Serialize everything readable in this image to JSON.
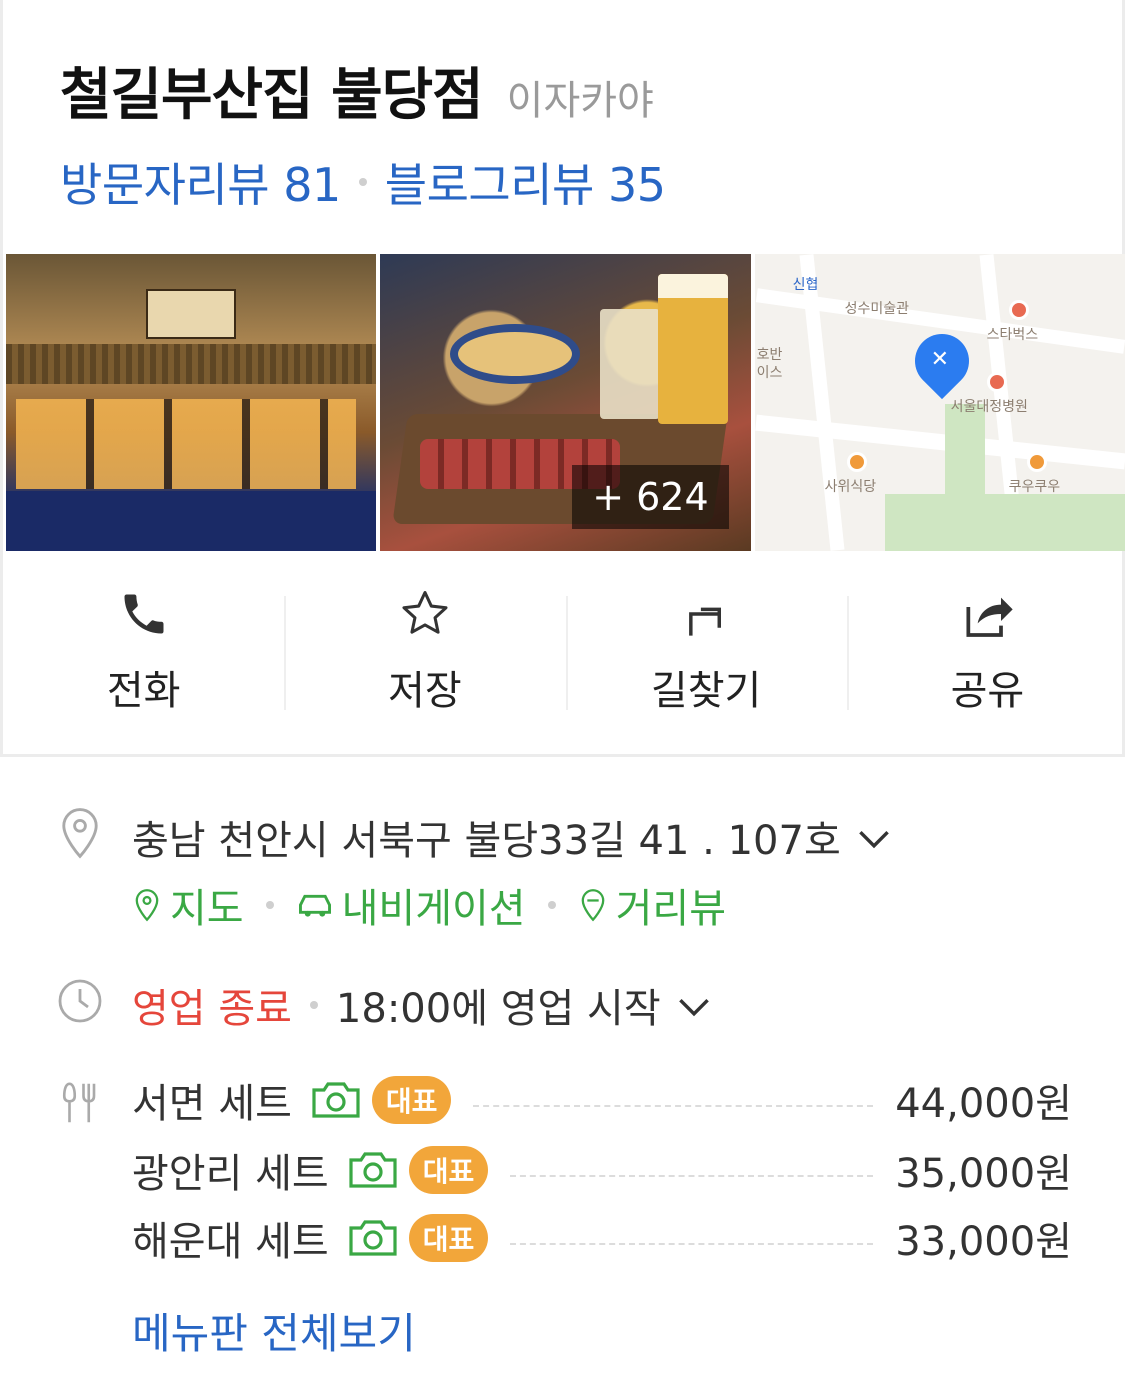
{
  "place": {
    "name": "철길부산집 불당점",
    "category": "이자카야",
    "visitor_reviews": "방문자리뷰 81",
    "blog_reviews": "블로그리뷰 35"
  },
  "photos": {
    "more_count": "+ 624",
    "map_labels": [
      "신협",
      "성수미술관",
      "스타벅스",
      "서울대정병원",
      "사위식당",
      "쿠우쿠우",
      "호반",
      "이스"
    ]
  },
  "actions": [
    {
      "label": "전화",
      "icon": "phone-icon"
    },
    {
      "label": "저장",
      "icon": "star-icon"
    },
    {
      "label": "길찾기",
      "icon": "directions-icon"
    },
    {
      "label": "공유",
      "icon": "share-icon"
    }
  ],
  "address": {
    "text": "충남 천안시 서북구 불당33길 41 . 107호",
    "links": [
      "지도",
      "내비게이션",
      "거리뷰"
    ]
  },
  "hours": {
    "status": "영업 종료",
    "next_open": "18:00에 영업 시작"
  },
  "menu": {
    "badge_label": "대표",
    "items": [
      {
        "name": "서면 세트",
        "price": "44,000원"
      },
      {
        "name": "광안리 세트",
        "price": "35,000원"
      },
      {
        "name": "해운대 세트",
        "price": "33,000원"
      }
    ],
    "view_all": "메뉴판 전체보기"
  },
  "colors": {
    "link_blue": "#2866c4",
    "green": "#3aa844",
    "closed_red": "#e5463b",
    "badge_orange": "#f2a63a"
  }
}
